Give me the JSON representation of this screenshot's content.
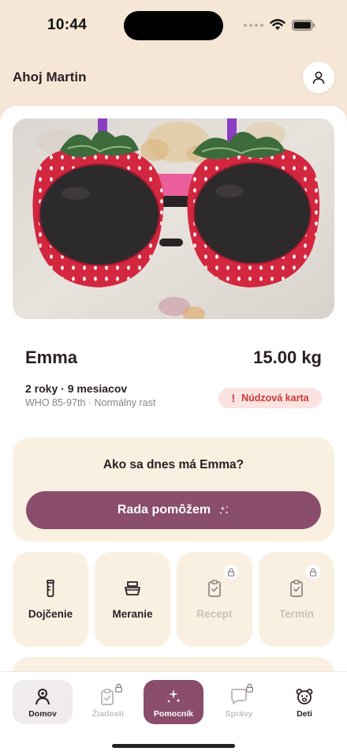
{
  "status_bar": {
    "time": "10:44"
  },
  "header": {
    "greeting": "Ahoj Martin"
  },
  "child": {
    "name": "Emma",
    "weight": "15.00 kg",
    "age": "2 roky · 9 mesiacov",
    "growth": "WHO 85-97th · Normálny rast",
    "emergency_label": "Núdzová karta"
  },
  "helper": {
    "question": "Ako sa dnes má Emma?",
    "button_label": "Rada pomôžem"
  },
  "tiles": [
    {
      "label": "Dojčenie",
      "icon": "bottle-icon",
      "locked": false
    },
    {
      "label": "Meranie",
      "icon": "scale-icon",
      "locked": false
    },
    {
      "label": "Recept",
      "icon": "clipboard-icon",
      "locked": true
    },
    {
      "label": "Termín",
      "icon": "clipboard-icon",
      "locked": true
    }
  ],
  "tabs": [
    {
      "label": "Domov",
      "icon": "person-icon",
      "state": "active"
    },
    {
      "label": "Žiadosti",
      "icon": "clipboard-icon",
      "state": "locked"
    },
    {
      "label": "Pomocník",
      "icon": "sparkle-icon",
      "state": "highlight"
    },
    {
      "label": "Správy",
      "icon": "chat-icon",
      "state": "locked"
    },
    {
      "label": "Deti",
      "icon": "bear-icon",
      "state": "normal"
    }
  ],
  "colors": {
    "accent": "#8a4d6c",
    "background_top": "#f5e6d6",
    "card": "#faf0e1",
    "emergency_bg": "#fbe3e1",
    "emergency_text": "#c93a34"
  }
}
